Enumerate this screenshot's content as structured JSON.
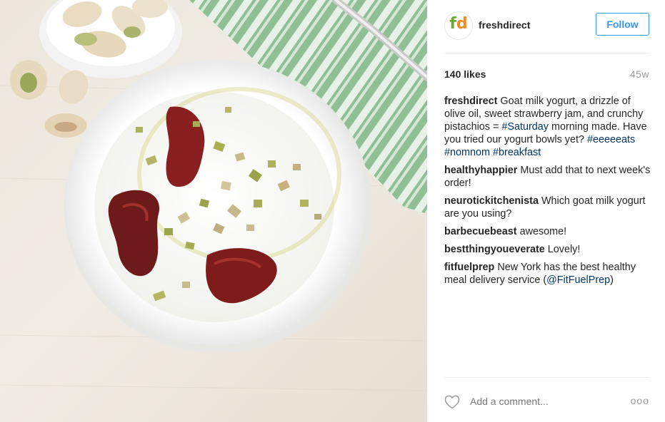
{
  "post": {
    "username": "freshdirect",
    "avatar_text_a": "f",
    "avatar_text_b": "d",
    "follow_label": "Follow",
    "likes": "140 likes",
    "age": "45w"
  },
  "caption": {
    "user": "freshdirect",
    "text_1": "Goat milk yogurt, a drizzle of olive oil, sweet strawberry jam, and crunchy pistachios = ",
    "tag_1": "#Saturday",
    "text_2": " morning made. Have you tried our yogurt bowls yet? ",
    "tag_2": "#eeeeeats",
    "tag_3": "#nomnom",
    "tag_4": "#breakfast"
  },
  "comments": [
    {
      "user": "healthyhappier",
      "text": "Must add that to next week's order!"
    },
    {
      "user": "neurotickitchenista",
      "text": "Which goat milk yogurt are you using?"
    },
    {
      "user": "barbecuebeast",
      "text": "awesome!"
    },
    {
      "user": "bestthingyoueverate",
      "text": "Lovely!"
    },
    {
      "user": "fitfuelprep",
      "text_before": "New York has the best healthy meal delivery service (",
      "mention": "@FitFuelPrep",
      "text_after": ")"
    }
  ],
  "footer": {
    "comment_placeholder": "Add a comment...",
    "more_label": "ooo"
  },
  "icons": {
    "like": "heart-icon",
    "more": "more-options-icon"
  },
  "colors": {
    "link": "#003569",
    "follow": "#3897f0",
    "muted": "#999999",
    "brand_green": "#6ea83b",
    "brand_orange": "#f08a24"
  }
}
